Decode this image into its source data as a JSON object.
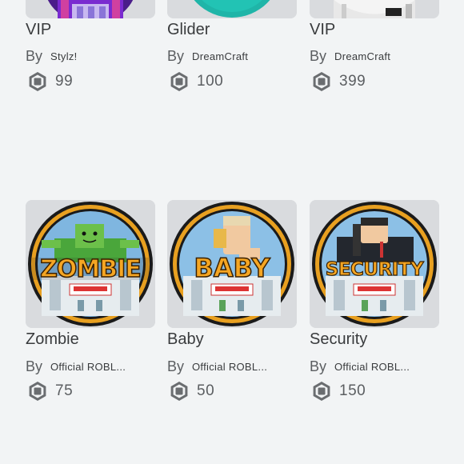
{
  "items": [
    {
      "name": "VIP",
      "by": "By",
      "creator": "Stylz!",
      "price": "99",
      "thumb": "vip-dress-thumbnail"
    },
    {
      "name": "Glider",
      "by": "By",
      "creator": "DreamCraft",
      "price": "100",
      "thumb": "glider-thumbnail"
    },
    {
      "name": "VIP",
      "by": "By",
      "creator": "DreamCraft",
      "price": "399",
      "thumb": "vip-badge-thumbnail"
    },
    {
      "name": "Zombie",
      "by": "By",
      "creator": "Official ROBL...",
      "price": "75",
      "thumb": "zombie-badge-thumbnail",
      "badge_text": "ZOMBIE"
    },
    {
      "name": "Baby",
      "by": "By",
      "creator": "Official ROBL...",
      "price": "50",
      "thumb": "baby-badge-thumbnail",
      "badge_text": "BABY"
    },
    {
      "name": "Security",
      "by": "By",
      "creator": "Official ROBL...",
      "price": "150",
      "thumb": "security-badge-thumbnail",
      "badge_text": "SECURITY"
    }
  ],
  "icons": {
    "currency": "robux-icon"
  },
  "colors": {
    "background": "#f2f4f5",
    "thumbnail_bg": "#d9dbde",
    "text_primary": "#393b3d",
    "text_secondary": "#5b5e61",
    "badge_gold": "#f0a020"
  }
}
